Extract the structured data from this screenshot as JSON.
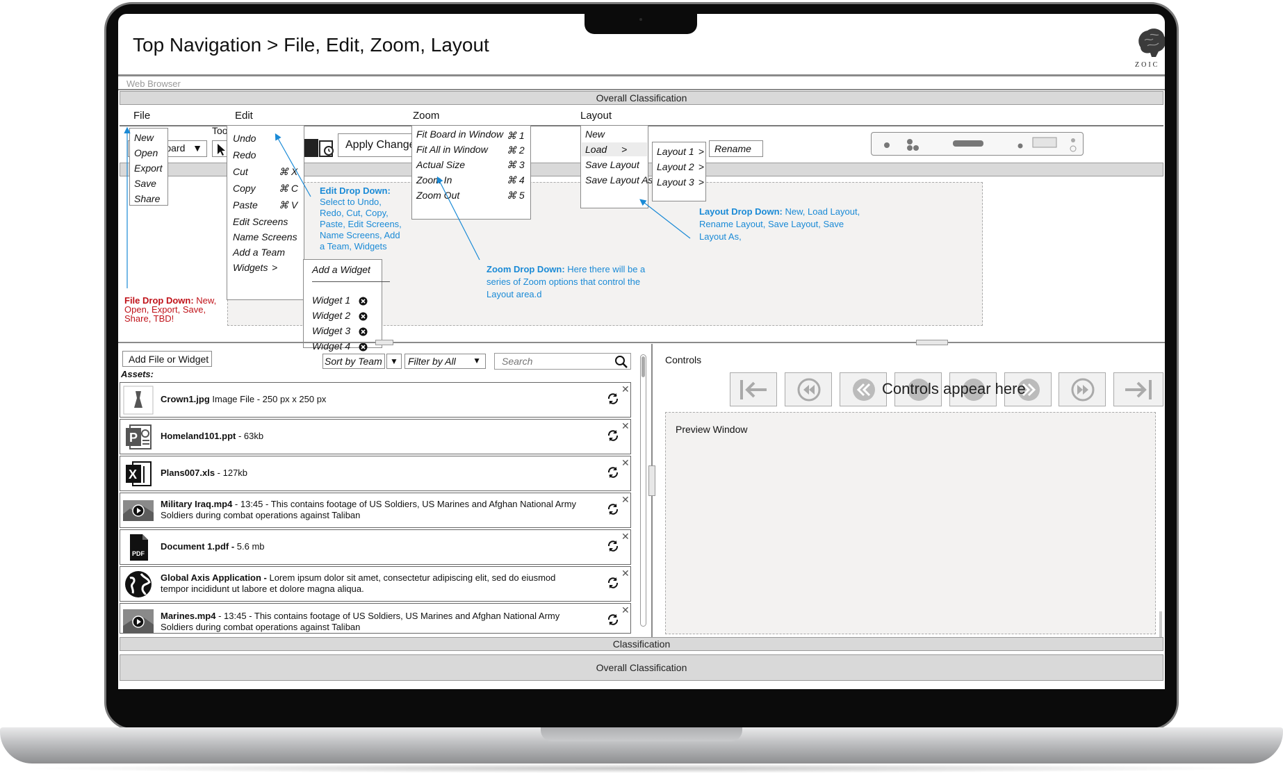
{
  "page_title": "Top Navigation > File, Edit, Zoom, Layout",
  "logo_text": "ZOIC",
  "browser_label": "Web Browser",
  "overall_classification": "Overall Classification",
  "classification": "Classification",
  "menus": {
    "file": "File",
    "edit": "Edit",
    "zoom": "Zoom",
    "layout": "Layout"
  },
  "toolbar": {
    "tools_label": "Too",
    "board_select": "Board",
    "apply_changes": "Apply Changes"
  },
  "file_dropdown": [
    "New",
    "Open",
    "Export",
    "Save",
    "Share"
  ],
  "edit_dropdown": {
    "items": [
      {
        "label": "Undo",
        "shortcut": ""
      },
      {
        "label": "Redo",
        "shortcut": ""
      },
      {
        "label": "Cut",
        "shortcut": "⌘ X"
      },
      {
        "label": "Copy",
        "shortcut": "⌘ C"
      },
      {
        "label": "Paste",
        "shortcut": "⌘ V"
      },
      {
        "label": "Edit Screens",
        "shortcut": ""
      },
      {
        "label": "Name Screens",
        "shortcut": ""
      },
      {
        "label": "Add a Team",
        "shortcut": ""
      },
      {
        "label": "Widgets",
        "shortcut": ">"
      }
    ]
  },
  "widgets_submenu": {
    "add": "Add a Widget",
    "separator": "————————",
    "items": [
      "Widget 1",
      "Widget 2",
      "Widget 3",
      "Widget 4"
    ]
  },
  "zoom_dropdown": [
    {
      "label": "Fit Board in Window",
      "shortcut": "⌘ 1"
    },
    {
      "label": "Fit All in Window",
      "shortcut": "⌘ 2"
    },
    {
      "label": "Actual Size",
      "shortcut": "⌘ 3"
    },
    {
      "label": "Zoom In",
      "shortcut": "⌘ 4"
    },
    {
      "label": "Zoom Out",
      "shortcut": "⌘ 5"
    }
  ],
  "layout_dropdown": [
    {
      "label": "New",
      "arrow": ""
    },
    {
      "label": "Load",
      "arrow": ">"
    },
    {
      "label": "Save Layout",
      "arrow": ""
    },
    {
      "label": "Save Layout As",
      "arrow": ""
    }
  ],
  "layout_submenu": [
    {
      "label": "Layout 1",
      "arrow": ">"
    },
    {
      "label": "Layout 2",
      "arrow": ">"
    },
    {
      "label": "Layout 3",
      "arrow": ">"
    }
  ],
  "rename_label": "Rename",
  "annotations": {
    "file_title": "File Drop Down:",
    "file_body": " New, Open, Export, Save, Share, TBD!",
    "edit_title": "Edit Drop Down:",
    "edit_body": "Select to Undo, Redo, Cut, Copy, Paste, Edit Screens, Name Screens, Add a Team, Widgets",
    "zoom_title": "Zoom Drop Down:",
    "zoom_body": " Here there will be a series of Zoom options that control the Layout area.d",
    "layout_title": "Layout Drop Down:",
    "layout_body": " New, Load Layout, Rename Layout, Save Layout, Save Layout As,"
  },
  "assets_panel": {
    "add_button": "Add  File or Widget",
    "sort_label": "Sort by Team",
    "filter_label": "Filter by All",
    "search_placeholder": "Search",
    "assets_heading": "Assets:",
    "items": [
      {
        "name": "Crown1.jpg",
        "desc": " Image File - 250 px x 250 px",
        "icon": "image-icon"
      },
      {
        "name": "Homeland101.ppt",
        "desc": " - 63kb",
        "icon": "powerpoint-icon"
      },
      {
        "name": "Plans007.xls",
        "desc": " - 127kb",
        "icon": "excel-icon"
      },
      {
        "name": "Military Iraq.mp4",
        "desc": " - 13:45 - This contains footage of US Soldiers, US Marines and Afghan National Army Soldiers during combat operations against Taliban",
        "icon": "video-icon"
      },
      {
        "name": "Document 1.pdf -",
        "desc": " 5.6 mb",
        "icon": "pdf-icon"
      },
      {
        "name": "Global Axis Application -",
        "desc": " Lorem ipsum dolor sit amet, consectetur adipiscing elit, sed do eiusmod tempor incididunt ut labore et dolore magna aliqua.",
        "icon": "globe-icon"
      },
      {
        "name": "Marines.mp4",
        "desc": " - 13:45 - This contains footage of US Soldiers, US Marines and Afghan National Army Soldiers during combat operations against Taliban",
        "icon": "video-icon"
      }
    ]
  },
  "controls_panel": {
    "label": "Controls",
    "overlay": "Controls appear here",
    "preview_label": "Preview Window"
  },
  "colors": {
    "annotation_blue": "#1a8ad6",
    "annotation_red": "#c0131a",
    "bar_gray": "#d9d9d9"
  }
}
